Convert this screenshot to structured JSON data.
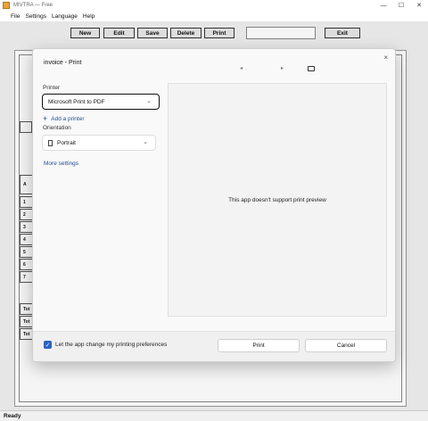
{
  "window": {
    "title": "MIVTRA — Free",
    "controls": {
      "minimize": "—",
      "maximize": "☐",
      "close": "✕"
    }
  },
  "menu": [
    "File",
    "Settings",
    "Language",
    "Help"
  ],
  "toolbar": {
    "buttons": [
      "New",
      "Edit",
      "Save",
      "Delete",
      "Print"
    ],
    "search_value": "",
    "exit_label": "Exit"
  },
  "background": {
    "row_labels": [
      "A",
      "1",
      "2",
      "3",
      "4",
      "5",
      "6",
      "7"
    ],
    "total_labels": [
      "Tot",
      "Tot",
      "Tot"
    ]
  },
  "print_dialog": {
    "title": "invoice - Print",
    "close_icon": "×",
    "nav": {
      "prev": "◂",
      "next": "▸"
    },
    "printer_label": "Printer",
    "printer_value": "Microsoft Print to PDF",
    "add_printer": "Add a printer",
    "orientation_label": "Orientation",
    "orientation_value": "Portrait",
    "more_settings": "More settings",
    "preview_message": "This app doesn't support print preview",
    "checkbox_label": "Let the app change my printing preferences",
    "checkbox_checked": true,
    "print_button": "Print",
    "cancel_button": "Cancel",
    "accent_color": "#2b63c0"
  },
  "status": {
    "text": "Ready"
  }
}
